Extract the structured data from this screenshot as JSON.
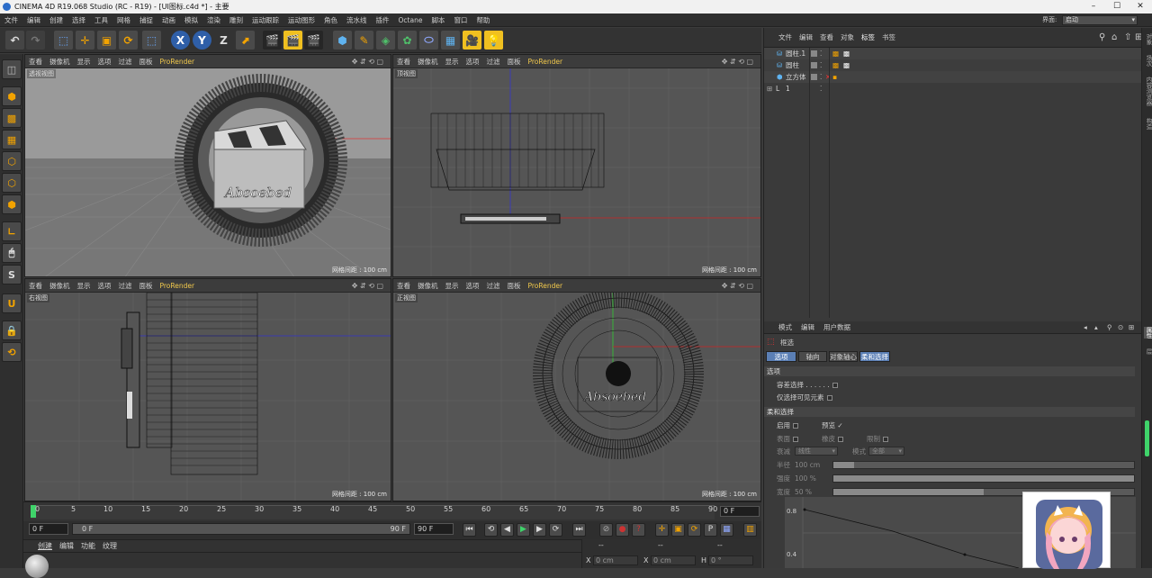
{
  "window": {
    "title": "CINEMA 4D R19.068 Studio (RC - R19) - [UI图标.c4d *] - 主要",
    "min": "–",
    "max": "☐",
    "close": "✕"
  },
  "menu": [
    "文件",
    "编辑",
    "创建",
    "选择",
    "工具",
    "网格",
    "捕捉",
    "动画",
    "模拟",
    "渲染",
    "雕刻",
    "运动跟踪",
    "运动图形",
    "角色",
    "流水线",
    "插件",
    "Octane",
    "脚本",
    "窗口",
    "帮助"
  ],
  "layout": {
    "label": "界面:",
    "value": "启动"
  },
  "toolbar": {
    "x": "X",
    "y": "Y",
    "z": "Z"
  },
  "viewport_menu": [
    "查看",
    "摄像机",
    "显示",
    "选项",
    "过滤",
    "面板"
  ],
  "viewport_prorender": "ProRender",
  "viewport_controls": "✥ ⇵ ⟲ ▢",
  "viewports": [
    {
      "label": "透视视图",
      "grid": "网格间距 : 100 cm"
    },
    {
      "label": "顶视图",
      "grid": "网格间距 : 100 cm"
    },
    {
      "label": "右视图",
      "grid": "网格间距 : 100 cm"
    },
    {
      "label": "正视图",
      "grid": "网格间距 : 100 cm"
    }
  ],
  "logo_text": "Absoebed",
  "axis": {
    "x": "x",
    "y": "y",
    "z": "z"
  },
  "timeline": {
    "ticks": [
      "0",
      "5",
      "10",
      "15",
      "20",
      "25",
      "30",
      "35",
      "40",
      "45",
      "50",
      "55",
      "60",
      "65",
      "70",
      "75",
      "80",
      "85",
      "90"
    ],
    "current": "0 F"
  },
  "playbar": {
    "start": "0 F",
    "range_start": "0 F",
    "range_end": "90 F",
    "end": "90 F"
  },
  "material_tabs": [
    "创建",
    "编辑",
    "功能",
    "纹理"
  ],
  "coords": {
    "dash1": "--",
    "dash2": "--",
    "dash3": "--",
    "x_label": "X",
    "x_val": "0 cm",
    "x2_label": "X",
    "x2_val": "0 cm",
    "h_label": "H",
    "h_val": "0 °"
  },
  "objects": {
    "tabs": [
      "文件",
      "编辑",
      "查看",
      "对象",
      "标签",
      "书签"
    ],
    "items": [
      {
        "name": "圆柱.1"
      },
      {
        "name": "圆柱"
      },
      {
        "name": "立方体"
      },
      {
        "name": "1"
      }
    ]
  },
  "attributes": {
    "tabs": [
      "模式",
      "编辑",
      "用户数据"
    ],
    "tool": "框选",
    "subtabs": [
      "选项",
      "轴向",
      "对象轴心",
      "柔和选择"
    ],
    "section_options": "选项",
    "tolerant": "容差选择 . . . . . .",
    "visible_only": "仅选择可见元素",
    "section_soft": "柔和选择",
    "enable": "启用",
    "preview": "预览",
    "preview_check": "✓",
    "surface": "表面",
    "rubber": "橡皮",
    "restrict": "限制",
    "falloff_label": "衰减",
    "falloff_value": "线性",
    "mode_label": "模式",
    "mode_value": "全部",
    "radius_label": "半径",
    "radius_value": "100 cm",
    "radius_fill": 0.07,
    "strength_label": "强度",
    "strength_value": "100 %",
    "strength_fill": 1.0,
    "width_label": "宽度",
    "width_value": "50 %",
    "width_fill": 0.5,
    "graph_y1": "0.8",
    "graph_y2": "0.4"
  },
  "right_strip": [
    "对象",
    "场次",
    "内容浏览器",
    "构造",
    "属性",
    "层"
  ]
}
